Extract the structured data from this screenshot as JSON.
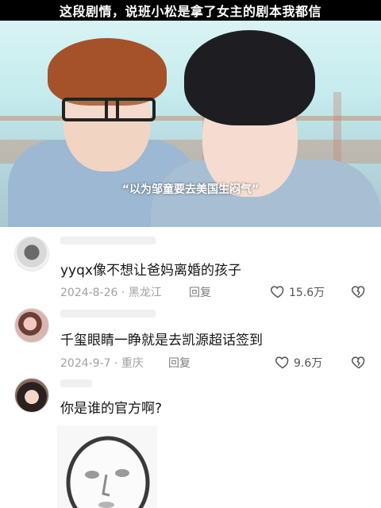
{
  "header": {
    "title": "这段剧情，说班小松是拿了女主的剧本我都信"
  },
  "video": {
    "subtitle": "“以为邹童要去美国生闷气”"
  },
  "comments": [
    {
      "text": "yyqx像不想让爸妈离婚的孩子",
      "date_location": "2024-8-26 · 黑龙江",
      "reply_label": "回复",
      "likes": "15.6万"
    },
    {
      "text": "千玺眼睛一睁就是去凯源超话签到",
      "date_location": "2024-9-7 · 重庆",
      "reply_label": "回复",
      "likes": "9.6万"
    },
    {
      "text": "你是谁的官方啊?"
    }
  ],
  "icons": {
    "like": "heart-outline-icon",
    "dislike": "broken-heart-icon"
  }
}
